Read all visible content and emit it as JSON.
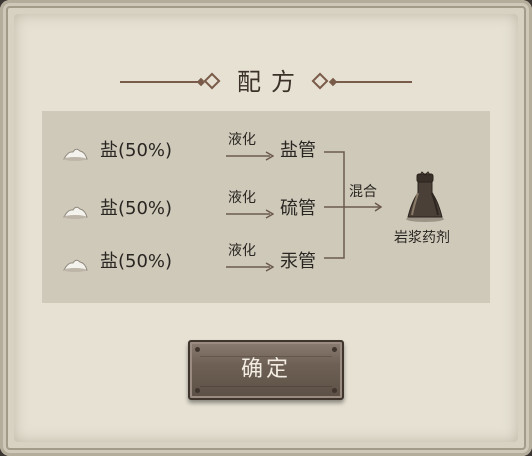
{
  "title": "配方",
  "ingredients": [
    {
      "icon": "salt-pile-icon",
      "label": "盐(50%)",
      "process": "液化",
      "product": "盐管"
    },
    {
      "icon": "salt-pile-icon",
      "label": "盐(50%)",
      "process": "液化",
      "product": "硫管"
    },
    {
      "icon": "salt-pile-icon",
      "label": "盐(50%)",
      "process": "液化",
      "product": "汞管"
    }
  ],
  "combine": {
    "process": "混合",
    "result": "岩浆药剂",
    "result_icon": "magma-potion-icon"
  },
  "confirm_label": "确定",
  "colors": {
    "paper": "#e6e1d3",
    "panel": "#cfc9ba",
    "accent": "#7a5a48",
    "button": "#6e6054"
  }
}
